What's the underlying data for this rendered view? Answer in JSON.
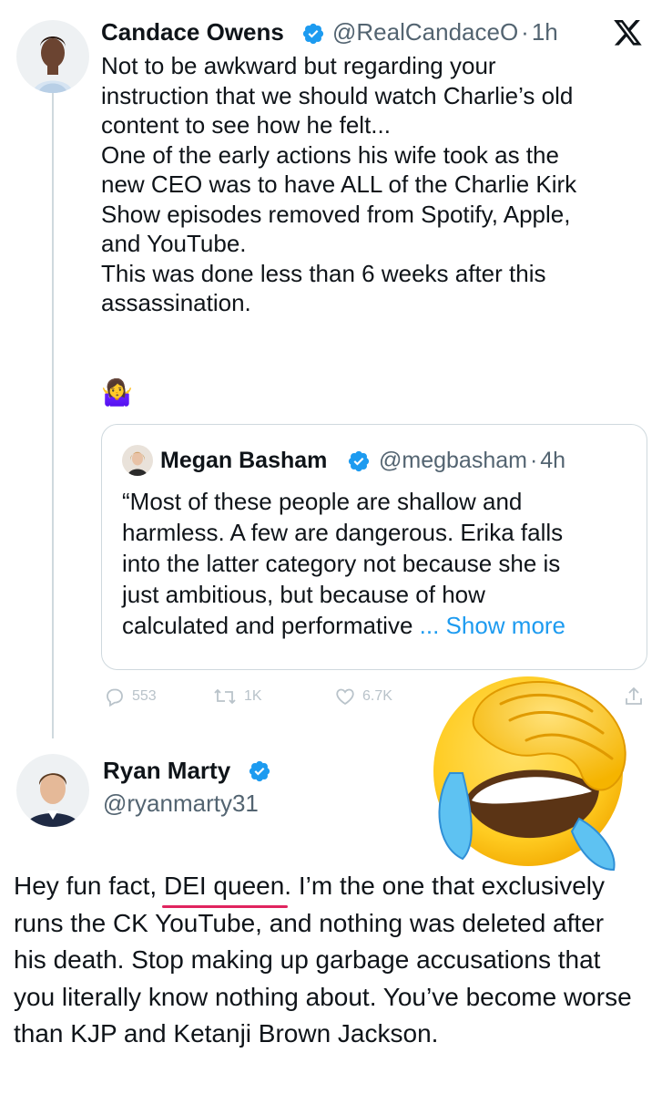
{
  "tweet": {
    "author_name": "Candace Owens",
    "author_handle": "@RealCandaceO",
    "separator": "·",
    "time": "1h",
    "text": "Not to be awkward but regarding your\ninstruction that we should watch Charlie’s old\ncontent to see how he felt...\nOne of the early actions his wife took as the\nnew CEO was to have ALL of the Charlie Kirk\nShow episodes removed from Spotify, Apple,\nand YouTube.\nThis was done less than 6 weeks after this\nassassination.",
    "emoji": "🤷‍♀️"
  },
  "quote": {
    "author_name": "Megan Basham",
    "author_handle": "@megbasham",
    "separator": "·",
    "time": "4h",
    "text_lines": [
      "“Most of these people are shallow and",
      "harmless. A few are dangerous. Erika falls",
      "into the latter category not because she is",
      "just ambitious, but because of how",
      "calculated and performative "
    ],
    "show_more": "... Show more"
  },
  "actions": {
    "replies": "553",
    "reposts": "1K",
    "likes": "6.7K"
  },
  "reply": {
    "author_name": "Ryan Marty",
    "author_handle": "@ryanmarty31",
    "text_before": "Hey fun fact, ",
    "text_highlight": "DEI queen",
    "text_after": ". I’m the one that exclusively runs the CK YouTube, and nothing was deleted after his death. Stop making up garbage accusations that you literally know nothing about. You’ve become worse than KJP and Ketanji Brown Jackson."
  },
  "overlay": {
    "emoji_name": "face-palm-crying-laughing-emoji"
  },
  "icons": {
    "x_logo": "x-logo-icon",
    "verified": "verified-badge-icon",
    "reply": "reply-icon",
    "repost": "repost-icon",
    "like": "heart-icon",
    "share": "share-icon"
  },
  "colors": {
    "link": "#1d9bf0",
    "verified": "#1d9bf0",
    "secondary_text": "#536471",
    "underline": "#e0245e"
  }
}
